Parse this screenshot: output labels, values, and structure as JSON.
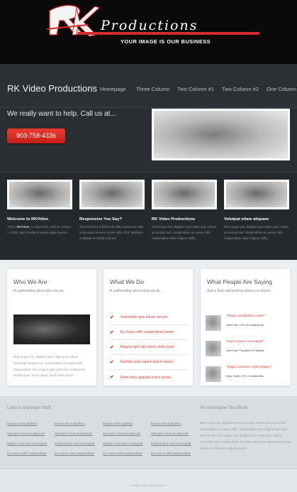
{
  "logo": {
    "text": "Productions",
    "tagline": "YOUR IMAGE IS OUR BUSINESS"
  },
  "nav": {
    "site_title": "RK Video Productions",
    "items": [
      {
        "label": "Homepage"
      },
      {
        "label": "Three Column"
      },
      {
        "label": "Two Column #1"
      },
      {
        "label": "Two Column #2"
      },
      {
        "label": "One Column"
      }
    ]
  },
  "hero": {
    "text": "We really want to help. Call us at...",
    "phone": "903-758-4336"
  },
  "features": [
    {
      "title": "Welcome to RKVideo",
      "lead": "This is",
      "lead_bold": "RKVideo",
      "text": ", a responsive, built on HTML5 + CSS3, and includes 5 unique page layouts."
    },
    {
      "title": "Responsive You Say?",
      "lead": "",
      "lead_bold": "",
      "text": "Yes! RKVideo is built to be fully responsive with looks great at every screen size, from desktops to tablets to mobile phones."
    },
    {
      "title": "RK Video Productions",
      "lead": "",
      "lead_bold": "",
      "text": "Duis neque nisi, dapibus sed mattis quis, rutrum accumsan sed. Suspendisse eu varius nibh. Suspendisse vitae magna mollis."
    },
    {
      "title": "Volutpat etiam aliquam",
      "lead": "",
      "lead_bold": "",
      "text": "Duis neque nisi, dapibus sed mattis quis, rutrum accumsan sed. Suspendisse eu varius nibh. Suspendisse vitae magna mollis."
    }
  ],
  "who": {
    "title": "Who We Are",
    "subtitle": "A subheading about who we are",
    "text": "Duis neque nisi, dapibus sed mattis quis, rutrum accumsan magna nec. Suspendisse eu varius nibh. Suspendisse vitae magna eget odio amet mollis justo facilisis quis. Sed congue, amet lorem ipsum."
  },
  "what": {
    "title": "What We Do",
    "subtitle": "A subheading about what we do",
    "items": [
      {
        "label": "Sed mattis quis rutrum accum"
      },
      {
        "label": "Eu varius nibh suspendisse lorem"
      },
      {
        "label": "Magna eget odio amet mollis justo"
      },
      {
        "label": "Facilisis quis sapien lorem mauris"
      },
      {
        "label": "Amet tellus gravida lorem ipsum"
      }
    ]
  },
  "people": {
    "title": "What People Are Saying",
    "subtitle": "And a final subheading about our clients",
    "testimonials": [
      {
        "quote": "\"Neque nisidapibus mattis\"",
        "name": "Jane Doe, CEO of UntitledCorp"
      },
      {
        "quote": "\"Lorem ipsum consequat!\"",
        "name": "John Doe, President of FakeBiz"
      },
      {
        "quote": "\"Magna veroeros amet tempus\"",
        "name": "Mary Smith, CFO of UntitledBiz"
      }
    ]
  },
  "footer": {
    "links_title": "Links to Important Stuff",
    "link_columns": [
      [
        "Neque amet dapibus",
        "Sed quis rhoncus placerat",
        "Magna nunc sed consequat",
        "Eu varius nibh suspendisse"
      ],
      [
        "Neque amet dapibus",
        "Sed quis rhoncus placerat",
        "Magna nunc sed consequat",
        "Eu varius nibh suspendisse"
      ],
      [
        "Neque amet dapibus",
        "Sed quis rhoncus placerat",
        "Magna nunc sed consequat",
        "Eu varius nibh suspendisse"
      ],
      [
        "Neque amet dapibus",
        "Sed quis rhoncus placerat",
        "Magna nunc sed consequat",
        "Eu varius nibh suspendisse"
      ]
    ],
    "blurb_title": "An Informative Text Blurb",
    "blurb_text": "Duis neque nisi, dapibus sed mattis quis, rutrum accumsan sed. Suspendisse eu varius nibh. Suspendisse vitae magna eget odio amet mollis. Duis neque nisi, dapibus sed mattis quis, rutrum accumsan sed. Suspendisse eu varius nibh lorem ipsum amet dolor sit amet consectetur adipiscing elit."
  },
  "copyright": "© Untitled. All rights reserved."
}
